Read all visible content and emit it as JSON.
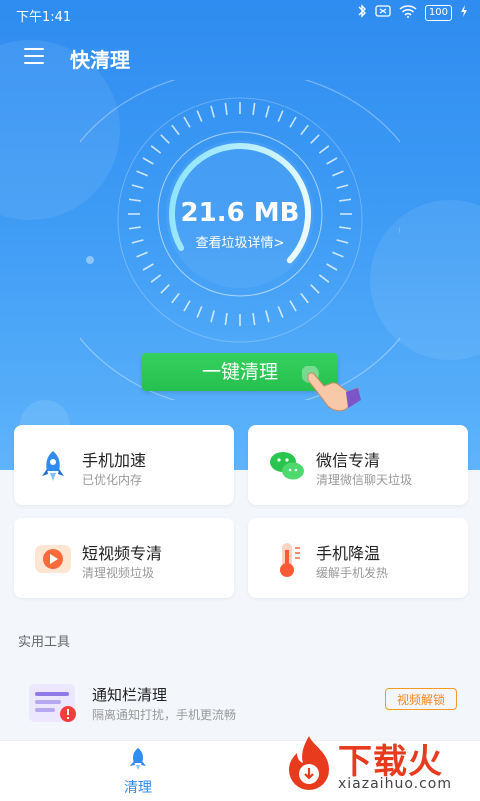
{
  "status_bar": {
    "time": "下午1:41",
    "battery": "100",
    "icons": [
      "bluetooth-icon",
      "sim-off-icon",
      "wifi-icon",
      "battery-icon",
      "charging-icon"
    ]
  },
  "app_bar": {
    "title": "快清理",
    "menu_icon": "menu-icon"
  },
  "dial": {
    "junk_size": "21.6 MB",
    "details_link": "查看垃圾详情>"
  },
  "main_button": {
    "label": "一键清理"
  },
  "feature_cards": [
    {
      "title": "手机加速",
      "subtitle": "已优化内存",
      "icon": "rocket-icon"
    },
    {
      "title": "微信专清",
      "subtitle": "清理微信聊天垃圾",
      "icon": "wechat-icon"
    },
    {
      "title": "短视频专清",
      "subtitle": "清理视频垃圾",
      "icon": "video-play-icon"
    },
    {
      "title": "手机降温",
      "subtitle": "缓解手机发热",
      "icon": "thermometer-icon"
    }
  ],
  "tools_section": {
    "title": "实用工具",
    "items": [
      {
        "title": "通知栏清理",
        "subtitle": "隔离通知打扰，手机更流畅",
        "button": "视频解锁",
        "icon": "notification-bar-icon"
      }
    ]
  },
  "bottom_nav": {
    "items": [
      {
        "label": "清理",
        "icon": "clean-rocket-icon",
        "active": true
      }
    ]
  },
  "watermark": {
    "brand": "下载火",
    "url": "xiazaihuo.com"
  },
  "colors": {
    "primary": "#2f8cf0",
    "button_green": "#2bc853",
    "tool_button_orange": "#f5871f"
  }
}
